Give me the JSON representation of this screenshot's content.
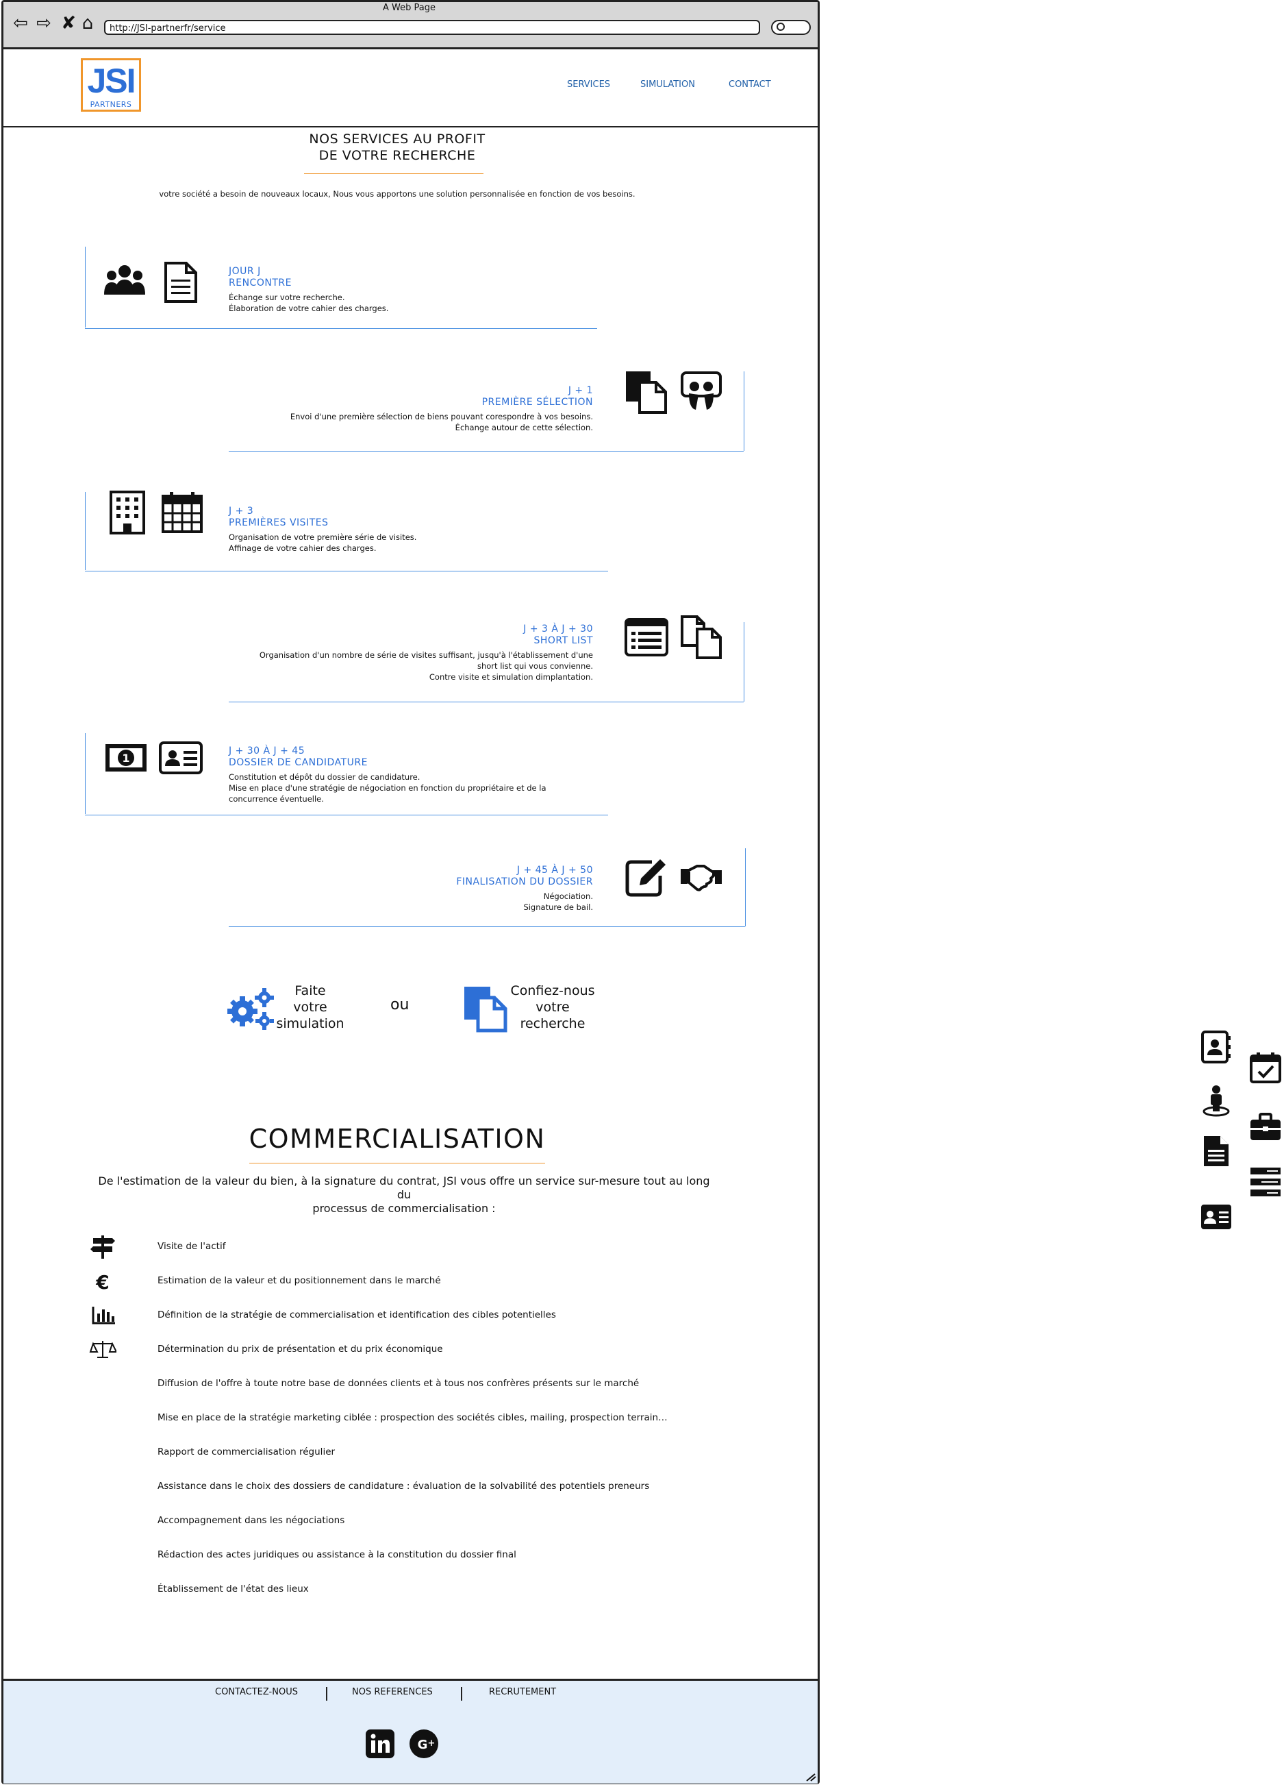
{
  "window": {
    "title": "A Web Page",
    "url": "http://JSI-partnerfr/service"
  },
  "logo": {
    "main": "JSI",
    "sub": "PARTNERS"
  },
  "nav": {
    "services": "SERVICES",
    "simulation": "SIMULATION",
    "contact": "CONTACT"
  },
  "services": {
    "title_line1": "NOS SERVICES AU PROFIT",
    "title_line2": "DE VOTRE RECHERCHE",
    "intro": "votre société a besoin de nouveaux locaux, Nous vous apportons une solution personnalisée en fonction de vos besoins."
  },
  "steps": [
    {
      "day": "JOUR J",
      "name": "RENCONTRE",
      "desc1": "Échange sur votre recherche.",
      "desc2": "Élaboration de votre cahier des charges.",
      "desc3": "",
      "icons": [
        "people-icon",
        "document-icon"
      ]
    },
    {
      "day": "J + 1",
      "name": "PREMIÈRE SÉLECTION",
      "desc1": "Envoi d'une première sélection de biens pouvant corespondre à vos besoins.",
      "desc2": "Échange autour de cette sélection.",
      "desc3": "",
      "icons": [
        "copy-icon",
        "slideshare-icon"
      ]
    },
    {
      "day": "J + 3",
      "name": "PREMIÈRES VISITES",
      "desc1": "Organisation de votre première série de visites.",
      "desc2": "Affinage de votre cahier des charges.",
      "desc3": "",
      "icons": [
        "building-icon",
        "calendar-icon"
      ]
    },
    {
      "day": "J + 3 À J + 30",
      "name": "SHORT LIST",
      "desc1": "Organisation d'un nombre de série de visites suffisant, jusqu'à l'établissement d'une",
      "desc2": "short list qui vous convienne.",
      "desc3": "Contre visite et simulation dimplantation.",
      "icons": [
        "list-icon",
        "files-icon"
      ]
    },
    {
      "day": "J + 30 À J + 45",
      "name": "DOSSIER DE CANDIDATURE",
      "desc1": "Constitution et dépôt du dossier de candidature.",
      "desc2": "Mise en place d'une stratégie de négociation en fonction du propriétaire et de la",
      "desc3": "concurrence éventuelle.",
      "icons": [
        "money-icon",
        "id-card-icon"
      ]
    },
    {
      "day": "J + 45 À J + 50",
      "name": "FINALISATION DU DOSSIER",
      "desc1": "Négociation.",
      "desc2": "Signature de bail.",
      "desc3": "",
      "icons": [
        "edit-icon",
        "handshake-icon"
      ]
    }
  ],
  "cta": {
    "simulation_l1": "Faite",
    "simulation_l2": "votre",
    "simulation_l3": "simulation",
    "or": "ou",
    "search_l1": "Confiez-nous",
    "search_l2": "votre",
    "search_l3": "recherche"
  },
  "commercialisation": {
    "title": "COMMERCIALISATION",
    "intro_l1": "De l'estimation de la valeur du bien, à la signature du contrat, JSI vous offre un service sur-mesure tout au long du",
    "intro_l2": "processus de commercialisation :",
    "items": [
      "Visite de l'actif",
      "Estimation de la valeur  et du positionnement dans le marché",
      "Définition de la stratégie de commercialisation et identification des cibles potentielles",
      "Détermination du prix de présentation et du prix économique",
      "Diffusion de l'offre à toute notre base de données clients et à tous nos confrères présents sur le marché",
      "Mise en place de la stratégie marketing ciblée : prospection des sociétés cibles, mailing, prospection terrain…",
      "Rapport de commercialisation régulier",
      "Assistance dans le choix des dossiers de candidature : évaluation de la solvabilité des potentiels preneurs",
      "Accompagnement dans les négociations",
      "Rédaction des actes juridiques ou assistance à la constitution du dossier final",
      "Établissement de l'état des lieux"
    ],
    "item_icons": [
      "signpost-icon",
      "euro-icon",
      "bar-chart-icon",
      "balance-icon"
    ]
  },
  "footer": {
    "contact": "CONTACTEZ-NOUS",
    "references": "NOS REFERENCES",
    "recruitment": "RECRUTEMENT",
    "social": [
      "linkedin-icon",
      "google-plus-icon"
    ]
  },
  "side_icons": [
    "address-book-icon",
    "calendar-check-icon",
    "user-location-icon",
    "briefcase-icon",
    "document-text-icon",
    "list-bars-icon",
    "id-badge-icon"
  ],
  "colors": {
    "accent_blue": "#2d6fd6",
    "line_blue": "#4a90e2",
    "orange": "#f0962b",
    "footer_bg": "#e3eefa"
  }
}
